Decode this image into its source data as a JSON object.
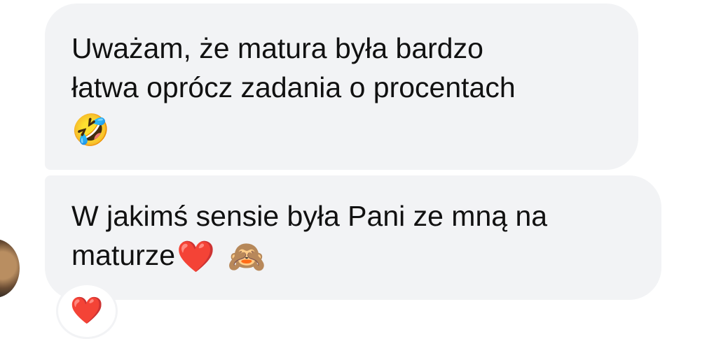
{
  "messages": [
    {
      "lines": [
        "Uważam, że matura była bardzo",
        "łatwa oprócz zadania o procentach"
      ],
      "emoji": "🤣",
      "emoji_name": "rolling-on-the-floor-laughing"
    },
    {
      "line1": "W jakimś sensie była Pani ze mną na",
      "line2_text": "maturze",
      "emoji_heart": "❤️",
      "emoji_monkey": "🙈"
    }
  ],
  "reaction": {
    "emoji": "❤️"
  },
  "colors": {
    "bubble_bg": "#f2f3f5",
    "text": "#111111",
    "heart": "#e01e2b"
  }
}
